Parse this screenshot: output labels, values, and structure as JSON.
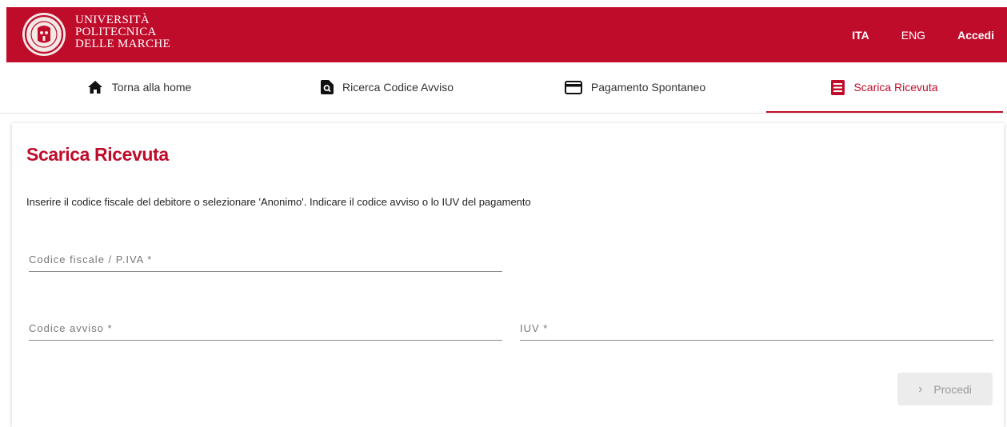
{
  "header": {
    "logo_lines": [
      "UNIVERSITÀ",
      "POLITECNICA",
      "DELLE MARCHE"
    ],
    "lang_ita": "ITA",
    "lang_eng": "ENG",
    "login_label": "Accedi"
  },
  "tabs": [
    {
      "label": "Torna alla home",
      "icon": "home-icon"
    },
    {
      "label": "Ricerca Codice Avviso",
      "icon": "file-search-icon"
    },
    {
      "label": "Pagamento Spontaneo",
      "icon": "credit-card-icon"
    },
    {
      "label": "Scarica Ricevuta",
      "icon": "receipt-icon",
      "active": true
    }
  ],
  "main": {
    "title": "Scarica Ricevuta",
    "intro": "Inserire il codice fiscale del debitore o selezionare 'Anonimo'. Indicare il codice avviso o lo IUV del pagamento",
    "fields": {
      "codice_fiscale": {
        "placeholder": "Codice fiscale / P.IVA *",
        "value": ""
      },
      "codice_avviso": {
        "placeholder": "Codice avviso *",
        "value": ""
      },
      "iuv": {
        "placeholder": "IUV *",
        "value": ""
      }
    },
    "submit_label": "Procedi"
  },
  "colors": {
    "brand": "#c00c2b",
    "disabled_button_bg": "#ececec"
  }
}
